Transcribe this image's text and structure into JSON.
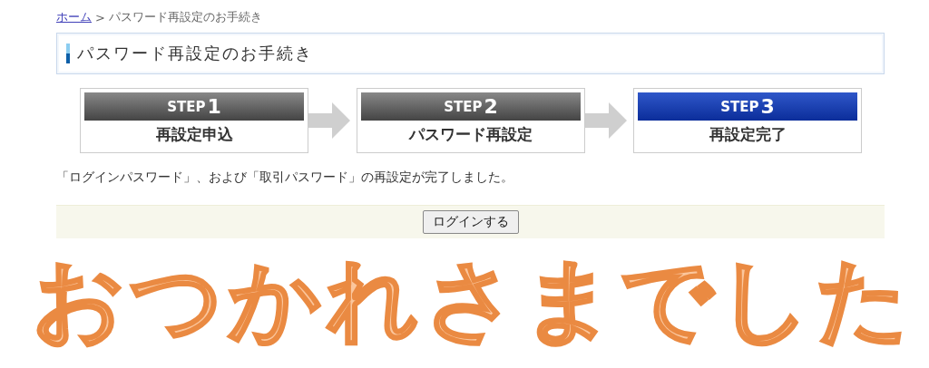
{
  "breadcrumb": {
    "home_link": "ホーム",
    "separator": ">",
    "current": "パスワード再設定のお手続き"
  },
  "page_title": "パスワード再設定のお手続き",
  "steps": [
    {
      "label": "STEP",
      "number": "1",
      "title": "再設定申込",
      "selected": false
    },
    {
      "label": "STEP",
      "number": "2",
      "title": "パスワード再設定",
      "selected": false
    },
    {
      "label": "STEP",
      "number": "3",
      "title": "再設定完了",
      "selected": true
    }
  ],
  "message": "「ログインパスワード」、および「取引パスワード」の再設定が完了しました。",
  "login_button": "ログインする",
  "overlay_caption": "おつかれさまでした"
}
